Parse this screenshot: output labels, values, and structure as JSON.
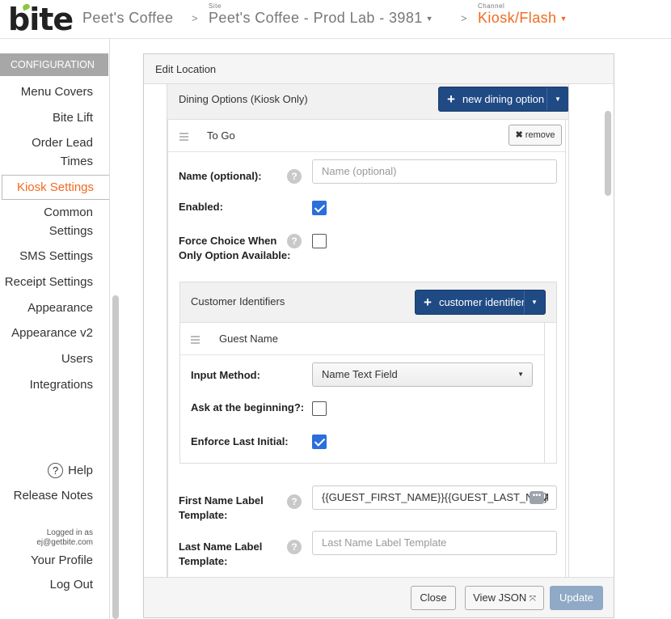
{
  "header": {
    "logo": "bite",
    "brand": "Peet's Coffee",
    "site_label": "Site",
    "site": "Peet's Coffee - Prod Lab - 3981",
    "channel_label": "Channel",
    "channel": "Kiosk/Flash",
    "separator": ">",
    "colors": {
      "accent": "#f26a21",
      "logo_leaf": "#8dc63f"
    }
  },
  "sidebar": {
    "section": "CONFIGURATION",
    "items": [
      {
        "label": "Menu Covers"
      },
      {
        "label": "Bite Lift"
      },
      {
        "label": "Order Lead",
        "label2": "Times"
      },
      {
        "label": "Kiosk Settings",
        "active": true
      },
      {
        "label": "Common",
        "label2": "Settings"
      },
      {
        "label": "SMS Settings"
      },
      {
        "label": "Receipt Settings"
      },
      {
        "label": "Appearance"
      },
      {
        "label": "Appearance v2"
      },
      {
        "label": "Users"
      },
      {
        "label": "Integrations"
      }
    ],
    "help": "Help",
    "help_icon": "?",
    "release_notes": "Release Notes",
    "logged_in_as": "Logged in as",
    "user_email": "ej@getbite.com",
    "your_profile": "Your Profile",
    "log_out": "Log Out"
  },
  "modal": {
    "title": "Edit Location",
    "dining": {
      "heading": "Dining Options (Kiosk Only)",
      "new_button": "new dining option",
      "option_name": "To Go",
      "remove_button": "remove",
      "fields": {
        "name_label": "Name (optional):",
        "name_placeholder": "Name (optional)",
        "enabled_label": "Enabled:",
        "enabled": true,
        "force_label_1": "Force Choice When",
        "force_label_2": "Only Option Available:",
        "force": false
      },
      "customer": {
        "heading": "Customer Identifiers",
        "add_button": "customer identifier",
        "item_name": "Guest Name",
        "input_method_label": "Input Method:",
        "input_method_value": "Name Text Field",
        "ask_label": "Ask at the beginning?:",
        "ask": false,
        "enforce_label": "Enforce Last Initial:",
        "enforce": true
      },
      "first_label_1": "First Name Label",
      "first_label_2": "Template:",
      "first_value": "{{GUEST_FIRST_NAME}}{{GUEST_LAST_NAM",
      "first_value_tail": "}",
      "last_label_1": "Last Name Label",
      "last_label_2": "Template:",
      "last_placeholder": "Last Name Label Template",
      "help_icon": "?",
      "more_icon": "•••"
    },
    "footer": {
      "close": "Close",
      "view_json": "View JSON",
      "update": "Update"
    }
  }
}
